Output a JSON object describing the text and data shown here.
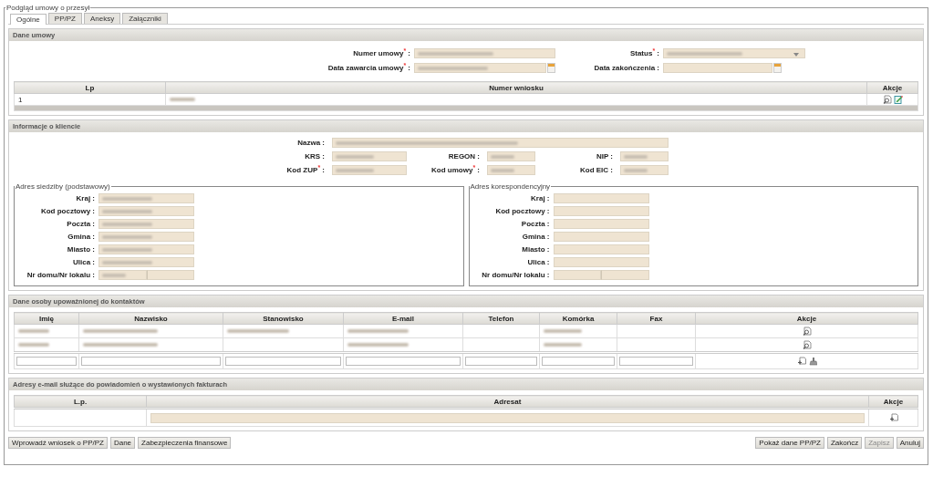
{
  "window": {
    "title": "Podgląd umowy o przesył"
  },
  "tabs": [
    {
      "label": "Ogólne",
      "selected": true
    },
    {
      "label": "PP/PZ",
      "selected": false
    },
    {
      "label": "Aneksy",
      "selected": false
    },
    {
      "label": "Załączniki",
      "selected": false
    }
  ],
  "contract": {
    "title": "Dane umowy",
    "fields": [
      {
        "label": "Numer umowy$^{*}$ :",
        "kind": "text",
        "blurred": true
      },
      {
        "label": "Status$^{*}$ :",
        "kind": "select",
        "blurred": true
      },
      {
        "label": "Data zawarcia umowy$^{*}$ :",
        "kind": "date",
        "blurred": true
      },
      {
        "label": "Data zakończenia :",
        "kind": "date",
        "blurred": false
      }
    ],
    "table": {
      "columns": [
        "Lp",
        "Numer wniosku",
        "Akcje"
      ],
      "rows": [
        {
          "cells": [
            {
              "text": "1"
            },
            {
              "blurred": true
            }
          ],
          "actions": [
            {
              "kind": "view"
            },
            {
              "kind": "edit"
            }
          ]
        }
      ]
    }
  },
  "client": {
    "title": "Informacje o kliencie",
    "fields": [
      {
        "label": "Nazwa :",
        "blurred": true,
        "wide": true
      },
      {
        "label": "KRS :",
        "blurred": true
      },
      {
        "label": "REGON :",
        "blurred": true
      },
      {
        "label": "NIP :",
        "blurred": true
      },
      {
        "label": "Kod ZUP$^{*}$ :",
        "blurred": true
      },
      {
        "label": "Kod umowy$^{*}$ :",
        "blurred": true
      },
      {
        "label": "Kod EIC :",
        "blurred": true
      }
    ],
    "addresses": [
      {
        "title": "Adres siedziby (podstawowy)",
        "fields": [
          {
            "label": "Kraj :",
            "blurred": true
          },
          {
            "label": "Kod pocztowy :",
            "blurred": true
          },
          {
            "label": "Poczta :",
            "blurred": true
          },
          {
            "label": "Gmina :",
            "blurred": true
          },
          {
            "label": "Miasto :",
            "blurred": true
          },
          {
            "label": "Ulica :",
            "blurred": true
          },
          {
            "label": "Nr domu/Nr lokalu :",
            "blurred": true,
            "split": true
          }
        ]
      },
      {
        "title": "Adres korespondencyjny",
        "fields": [
          {
            "label": "Kraj :",
            "blurred": false
          },
          {
            "label": "Kod pocztowy :",
            "blurred": false
          },
          {
            "label": "Poczta :",
            "blurred": false
          },
          {
            "label": "Gmina :",
            "blurred": false
          },
          {
            "label": "Miasto :",
            "blurred": false
          },
          {
            "label": "Ulica :",
            "blurred": false
          },
          {
            "label": "Nr domu/Nr lokalu :",
            "blurred": false,
            "split": true
          }
        ]
      }
    ]
  },
  "contacts": {
    "title": "Dane osoby upoważnionej do kontaktów",
    "columns": [
      "Imię",
      "Nazwisko",
      "Stanowisko",
      "E-mail",
      "Telefon",
      "Komórka",
      "Fax",
      "Akcje"
    ],
    "rows": [
      {
        "cells": [
          {
            "blurred": true
          },
          {
            "blurred": true
          },
          {
            "blurred": true
          },
          {
            "blurred": true
          },
          {
            "blurred": false
          },
          {
            "blurred": true
          },
          {
            "blurred": false
          }
        ],
        "actions": [
          {
            "kind": "view"
          }
        ]
      },
      {
        "cells": [
          {
            "blurred": true
          },
          {
            "blurred": true
          },
          {
            "blurred": false
          },
          {
            "blurred": true
          },
          {
            "blurred": false
          },
          {
            "blurred": true
          },
          {
            "blurred": false
          }
        ],
        "actions": [
          {
            "kind": "view"
          }
        ]
      }
    ],
    "new_row": {
      "actions": [
        {
          "kind": "add"
        },
        {
          "kind": "clear"
        }
      ]
    }
  },
  "emails": {
    "title": "Adresy e-mail służące do powiadomień o wystawionych fakturach",
    "columns": [
      "L.p.",
      "Adresat",
      "Akcje"
    ],
    "new_row": {
      "actions": [
        {
          "kind": "add"
        }
      ]
    }
  },
  "buttons_left": [
    {
      "label": "Wprowadź wniosek o PP/PZ",
      "disabled": false
    },
    {
      "label": "Dane",
      "disabled": false
    },
    {
      "label": "Zabezpieczenia finansowe",
      "disabled": false
    }
  ],
  "buttons_right": [
    {
      "label": "Pokaż dane PP/PZ",
      "disabled": false
    },
    {
      "label": "Zakończ",
      "disabled": false
    },
    {
      "label": "Zapisz",
      "disabled": true
    },
    {
      "label": "Anuluj",
      "disabled": false
    }
  ]
}
